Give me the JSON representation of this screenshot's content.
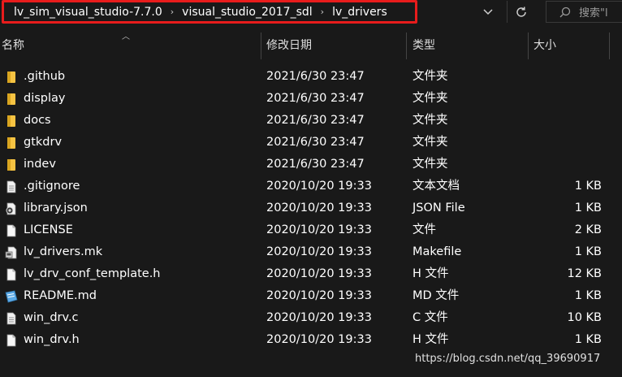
{
  "breadcrumb": {
    "items": [
      "lv_sim_visual_studio-7.7.0",
      "visual_studio_2017_sdl",
      "lv_drivers"
    ]
  },
  "search": {
    "placeholder": "搜索\"lv_drivers\"",
    "visible_text": "搜索\"l"
  },
  "icons": {
    "separator": "chevron-right-icon",
    "dropdown": "chevron-down-icon",
    "refresh": "refresh-icon",
    "search": "search-icon"
  },
  "columns": {
    "name": "名称",
    "date": "修改日期",
    "type": "类型",
    "size": "大小"
  },
  "files": [
    {
      "name": ".github",
      "date": "2021/6/30 23:47",
      "type": "文件夹",
      "size": "",
      "icon": "folder-icon"
    },
    {
      "name": "display",
      "date": "2021/6/30 23:47",
      "type": "文件夹",
      "size": "",
      "icon": "folder-icon"
    },
    {
      "name": "docs",
      "date": "2021/6/30 23:47",
      "type": "文件夹",
      "size": "",
      "icon": "folder-icon"
    },
    {
      "name": "gtkdrv",
      "date": "2021/6/30 23:47",
      "type": "文件夹",
      "size": "",
      "icon": "folder-icon"
    },
    {
      "name": "indev",
      "date": "2021/6/30 23:47",
      "type": "文件夹",
      "size": "",
      "icon": "folder-icon"
    },
    {
      "name": ".gitignore",
      "date": "2020/10/20 19:33",
      "type": "文本文档",
      "size": "1 KB",
      "icon": "text-file-icon"
    },
    {
      "name": "library.json",
      "date": "2020/10/20 19:33",
      "type": "JSON File",
      "size": "1 KB",
      "icon": "json-file-icon"
    },
    {
      "name": "LICENSE",
      "date": "2020/10/20 19:33",
      "type": "文件",
      "size": "2 KB",
      "icon": "file-icon"
    },
    {
      "name": "lv_drivers.mk",
      "date": "2020/10/20 19:33",
      "type": "Makefile",
      "size": "1 KB",
      "icon": "makefile-icon"
    },
    {
      "name": "lv_drv_conf_template.h",
      "date": "2020/10/20 19:33",
      "type": "H 文件",
      "size": "12 KB",
      "icon": "file-icon"
    },
    {
      "name": "README.md",
      "date": "2020/10/20 19:33",
      "type": "MD 文件",
      "size": "1 KB",
      "icon": "markdown-file-icon"
    },
    {
      "name": "win_drv.c",
      "date": "2020/10/20 19:33",
      "type": "C 文件",
      "size": "10 KB",
      "icon": "text-file-icon"
    },
    {
      "name": "win_drv.h",
      "date": "2020/10/20 19:33",
      "type": "H 文件",
      "size": "1 KB",
      "icon": "file-icon"
    }
  ],
  "watermark": "https://blog.csdn.net/qq_39690917",
  "colors": {
    "background": "#191919",
    "highlight_border": "#e81c1c",
    "folder": "#f6c342"
  }
}
